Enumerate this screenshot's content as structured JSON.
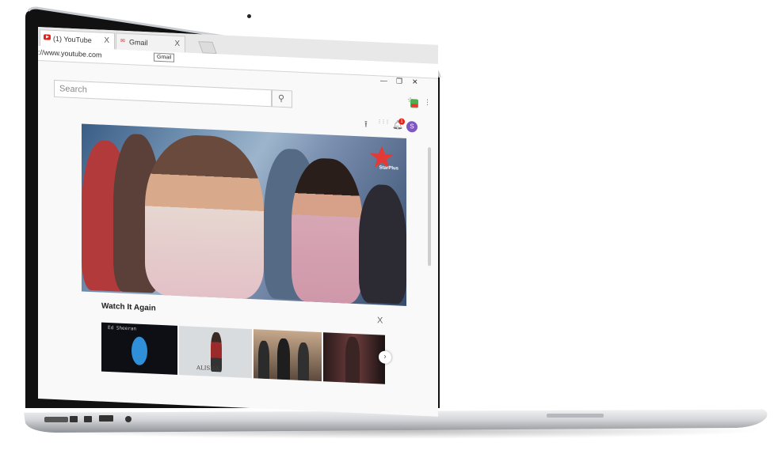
{
  "browser": {
    "tabs": [
      {
        "label": "(1) YouTube",
        "favicon": "youtube-icon",
        "active": true
      },
      {
        "label": "Gmail",
        "favicon": "gmail-icon",
        "active": false
      }
    ],
    "tooltip": "Gmail",
    "url": "://www.youtube.com",
    "close_glyph": "X",
    "window_controls": {
      "minimize": "—",
      "restore": "❐",
      "close": "✕"
    }
  },
  "youtube": {
    "search": {
      "placeholder": "Search"
    },
    "search_icon": "⚲",
    "upload_icon": "⭱",
    "apps_icon": "⋮⋮⋮",
    "notification_count": "1",
    "avatar_letter": "S",
    "video": {
      "channel_logo_text": "StarPlus"
    },
    "shelf": {
      "title": "Watch It Again",
      "close_glyph": "X",
      "next_glyph": "›",
      "thumbnails": [
        {
          "caption": "Ed Sheeran"
        },
        {
          "caption": "ALISHA"
        },
        {
          "caption": ""
        },
        {
          "caption": ""
        }
      ]
    }
  },
  "colors": {
    "youtube_red": "#e62117",
    "avatar_purple": "#7e57c2",
    "bezel": "#111111",
    "aluminum": "#c9ccd0"
  }
}
